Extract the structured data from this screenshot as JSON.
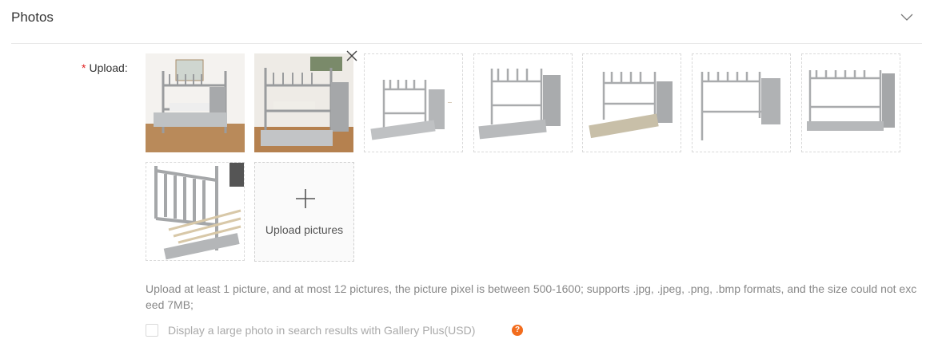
{
  "section": {
    "title": "Photos",
    "toggle_icon": "chevron-down-icon"
  },
  "upload": {
    "required_mark": "*",
    "label": "Upload:",
    "photos": [
      {
        "alt": "bunk bed photo 1",
        "style": "room-photo"
      },
      {
        "alt": "bunk bed photo 2",
        "style": "room-photo"
      },
      {
        "alt": "bunk bed photo 3",
        "style": "product-white"
      },
      {
        "alt": "bunk bed photo 4",
        "style": "product-white"
      },
      {
        "alt": "bunk bed photo 5",
        "style": "product-white"
      },
      {
        "alt": "bunk bed photo 6",
        "style": "product-white"
      },
      {
        "alt": "bunk bed photo 7",
        "style": "product-white"
      },
      {
        "alt": "bunk bed photo 8",
        "style": "detail-closeup"
      }
    ],
    "remove_icon": "close-icon",
    "add_icon": "plus-icon",
    "add_label": "Upload pictures",
    "hint": "Upload at least 1 picture, and at most 12 pictures, the picture pixel is between 500-1600; supports .jpg, .jpeg, .png, .bmp formats, and the size could not exceed 7MB;"
  },
  "gallery_plus": {
    "checked": false,
    "label": "Display a large photo in search results with Gallery Plus(USD)",
    "help_icon": "question-icon",
    "help_mark": "?"
  },
  "colors": {
    "required": "#e02020",
    "help_badge": "#f26c1d",
    "hint_text": "#888888"
  }
}
